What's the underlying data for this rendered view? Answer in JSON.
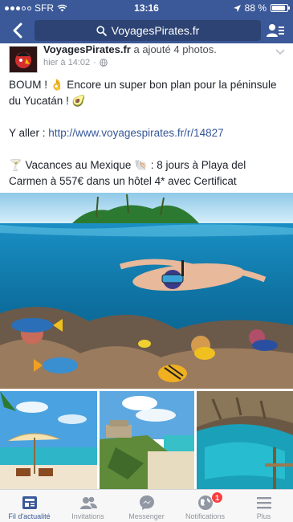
{
  "status_bar": {
    "carrier": "SFR",
    "time": "13:16",
    "battery": "88 %",
    "battery_level": 0.88
  },
  "nav": {
    "search_text": "VoyagesPirates.fr",
    "back_icon": "chevron-left-icon",
    "friends_icon": "person-list-icon"
  },
  "post": {
    "author": "VoyagesPirates.fr",
    "action": " a ajouté 4 photos.",
    "time": "hier à 14:02",
    "privacy_icon": "globe-icon",
    "text_line1": "BOUM ! 👌 Encore un super bon plan pour la péninsule du Yucatán ! 🥑",
    "text_line2_label": "Y aller : ",
    "text_line2_link": "http://www.voyagespirates.fr/r/14827",
    "text_line3": "🍸 Vacances au Mexique 🐚 : 8 jours à Playa del Carmen à 557€ dans un hôtel 4* avec Certificat d'Excellence et chambre avec balcon, vol A/R et transfert en taxi inclus"
  },
  "tabs": [
    {
      "label": "Fil d'actualité",
      "icon": "news-feed-icon",
      "active": true
    },
    {
      "label": "Invitations",
      "icon": "friends-icon",
      "active": false
    },
    {
      "label": "Messenger",
      "icon": "messenger-icon",
      "active": false
    },
    {
      "label": "Notifications",
      "icon": "globe-notification-icon",
      "active": false,
      "badge": "1"
    },
    {
      "label": "Plus",
      "icon": "menu-icon",
      "active": false
    }
  ],
  "colors": {
    "brand": "#3b5998",
    "link": "#365899",
    "badge": "#fa3e3e"
  }
}
